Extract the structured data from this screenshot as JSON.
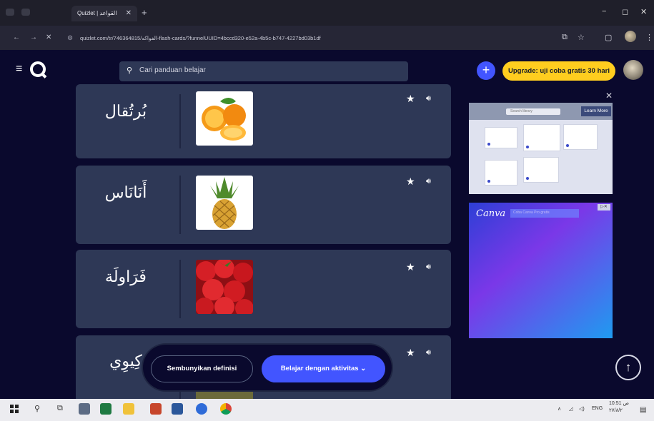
{
  "browser": {
    "tab_title": "Quizlet | القواعد",
    "tab_close": "✕",
    "new_tab": "+",
    "minimize": "−",
    "close": "✕",
    "url": "quizlet.com/tr/746364815/الفواكه-flash-cards/?funnelUUID=4bccd320-e52a-4b5c-b747-4227bd03b1df"
  },
  "header": {
    "search_placeholder": "Cari panduan belajar",
    "plus_label": "+",
    "upgrade_label": "Upgrade: uji coba gratis 30 hari"
  },
  "cards": [
    {
      "term": "بُرتُقال",
      "image": "orange"
    },
    {
      "term": "أَنَانَاس",
      "image": "pineapple"
    },
    {
      "term": "فَرَاولَة",
      "image": "strawberry"
    },
    {
      "term": "كِيوِي",
      "image": "kiwi"
    }
  ],
  "ads": {
    "close": "✕",
    "ad1_search": "Search library",
    "ad1_learn_more": "Learn More",
    "canva_logo": "Canva",
    "canva_cta": "Coba Canva Pro gratis"
  },
  "bottom_bar": {
    "hide_definitions": "Sembunyikan definisi",
    "learn_activities": "Belajar dengan aktivitas  ⌄"
  },
  "taskbar": {
    "lang": "ENG",
    "time": "10:51 ص",
    "date": "٢٧/٨/٢"
  },
  "colors": {
    "background": "#0a092d",
    "card": "#2e3856",
    "primary": "#4255ff",
    "upgrade": "#ffcd1f"
  }
}
